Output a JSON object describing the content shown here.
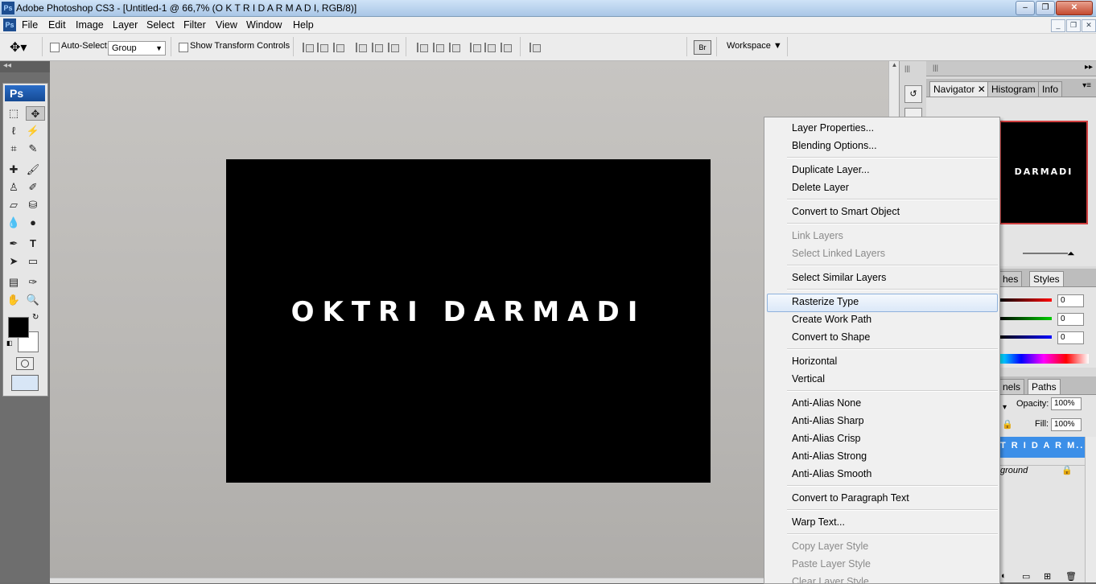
{
  "window": {
    "title": "Adobe Photoshop CS3 - [Untitled-1 @ 66,7% (O K T R I  D A R M A D I, RGB/8)]",
    "app_icon": "Ps",
    "controls": [
      "minimize-icon",
      "restore-icon",
      "close-icon"
    ]
  },
  "menubar": {
    "items": [
      "File",
      "Edit",
      "Image",
      "Layer",
      "Select",
      "Filter",
      "View",
      "Window",
      "Help"
    ]
  },
  "options": {
    "auto_select_label": "Auto-Select:",
    "auto_select_value": "Group",
    "transform_label": "Show Transform Controls",
    "workspace_label": "Workspace"
  },
  "tools": {
    "logo": "Ps",
    "items": [
      "marquee-icon",
      "move-icon",
      "lasso-icon",
      "magic-wand-icon",
      "crop-icon",
      "slice-icon",
      "healing-icon",
      "brush-icon",
      "clone-stamp-icon",
      "history-brush-icon",
      "eraser-icon",
      "paint-bucket-icon",
      "blur-icon",
      "dodge-icon",
      "pen-icon",
      "type-icon",
      "path-select-icon",
      "rectangle-icon",
      "notes-icon",
      "eyedropper-icon",
      "hand-icon",
      "zoom-icon"
    ]
  },
  "canvas": {
    "text": "OKTRI DARMADI",
    "background": "#000000",
    "text_color": "#ffffff"
  },
  "navigator": {
    "tabs": [
      "Navigator",
      "Histogram",
      "Info"
    ],
    "preview_text": "DARMADI"
  },
  "color_panel": {
    "tabs": [
      "hes",
      "Styles"
    ],
    "values": [
      "0",
      "0",
      "0"
    ]
  },
  "layers_panel": {
    "tabs": [
      "nels",
      "Paths"
    ],
    "opacity_label": "Opacity:",
    "opacity_value": "100%",
    "fill_label": "Fill:",
    "fill_value": "100%",
    "layers": [
      "T R I  D A R M...",
      "ground"
    ]
  },
  "context_menu": {
    "highlight_color": "#dbe8f8",
    "groups": [
      [
        {
          "label": "Layer Properties...",
          "enabled": true
        },
        {
          "label": "Blending Options...",
          "enabled": true
        }
      ],
      [
        {
          "label": "Duplicate Layer...",
          "enabled": true
        },
        {
          "label": "Delete Layer",
          "enabled": true
        }
      ],
      [
        {
          "label": "Convert to Smart Object",
          "enabled": true
        }
      ],
      [
        {
          "label": "Link Layers",
          "enabled": false
        },
        {
          "label": "Select Linked Layers",
          "enabled": false
        }
      ],
      [
        {
          "label": "Select Similar Layers",
          "enabled": true
        }
      ],
      [
        {
          "label": "Rasterize Type",
          "enabled": true,
          "highlighted": true
        },
        {
          "label": "Create Work Path",
          "enabled": true
        },
        {
          "label": "Convert to Shape",
          "enabled": true
        }
      ],
      [
        {
          "label": "Horizontal",
          "enabled": true
        },
        {
          "label": "Vertical",
          "enabled": true
        }
      ],
      [
        {
          "label": "Anti-Alias None",
          "enabled": true
        },
        {
          "label": "Anti-Alias Sharp",
          "enabled": true
        },
        {
          "label": "Anti-Alias Crisp",
          "enabled": true
        },
        {
          "label": "Anti-Alias Strong",
          "enabled": true
        },
        {
          "label": "Anti-Alias Smooth",
          "enabled": true
        }
      ],
      [
        {
          "label": "Convert to Paragraph Text",
          "enabled": true
        }
      ],
      [
        {
          "label": "Warp Text...",
          "enabled": true
        }
      ],
      [
        {
          "label": "Copy Layer Style",
          "enabled": false
        },
        {
          "label": "Paste Layer Style",
          "enabled": false
        },
        {
          "label": "Clear Layer Style",
          "enabled": false
        }
      ]
    ]
  }
}
